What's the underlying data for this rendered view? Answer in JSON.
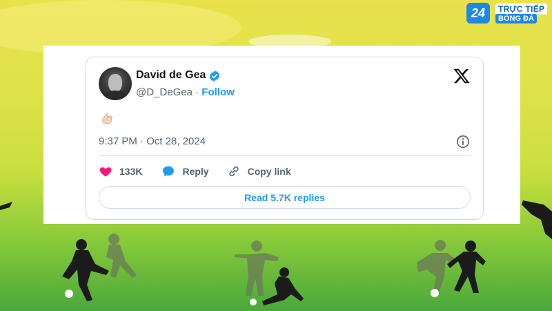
{
  "logo": {
    "badge": "24",
    "line1": "TRỰC TIẾP",
    "line2": "BÓNG ĐÁ"
  },
  "tweet": {
    "author_name": "David de Gea",
    "handle": "@D_DeGea",
    "separator": " · ",
    "follow_label": "Follow",
    "content_emoji": "👌",
    "timestamp": "9:37 PM · Oct 28, 2024",
    "likes_count": "133K",
    "reply_label": "Reply",
    "copy_link_label": "Copy link",
    "read_replies_label": "Read 5.7K replies"
  },
  "colors": {
    "accent": "#1d9bf0",
    "like": "#f91880",
    "text_primary": "#0f1419",
    "text_secondary": "#536471",
    "border": "#cfd9de"
  },
  "icons": [
    "verified-badge-icon",
    "x-logo-icon",
    "info-icon",
    "heart-icon",
    "reply-bubble-icon",
    "link-icon"
  ]
}
